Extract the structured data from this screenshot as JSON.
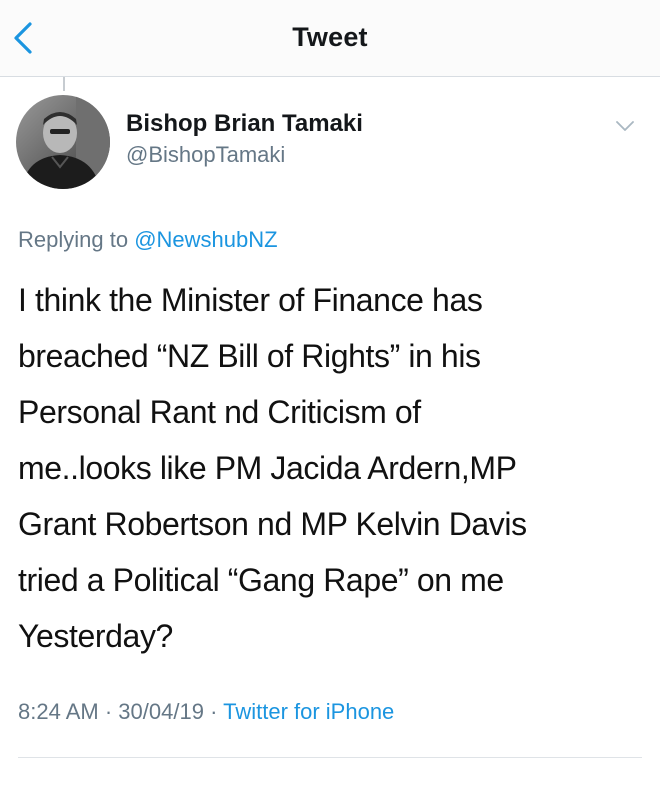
{
  "nav": {
    "title": "Tweet",
    "back_icon": "chevron-left-icon"
  },
  "tweet": {
    "author_name": "Bishop Brian Tamaki",
    "author_handle": "@BishopTamaki",
    "replying_prefix": "Replying to",
    "replying_to": "@NewshubNZ",
    "text_lines": [
      "I think the Minister of Finance has",
      "breached “NZ Bill of Rights” in his",
      "Personal Rant nd Criticism of",
      "me..looks like PM Jacida Ardern,MP",
      "Grant Robertson nd MP Kelvin Davis",
      "tried a Political “Gang Rape” on me",
      "Yesterday?"
    ],
    "time": "8:24 AM",
    "date": "30/04/19",
    "source": "Twitter for iPhone",
    "more_icon": "chevron-down-icon"
  },
  "colors": {
    "accent": "#1b95e0",
    "secondary_text": "#657786",
    "divider": "#d8dde2"
  }
}
